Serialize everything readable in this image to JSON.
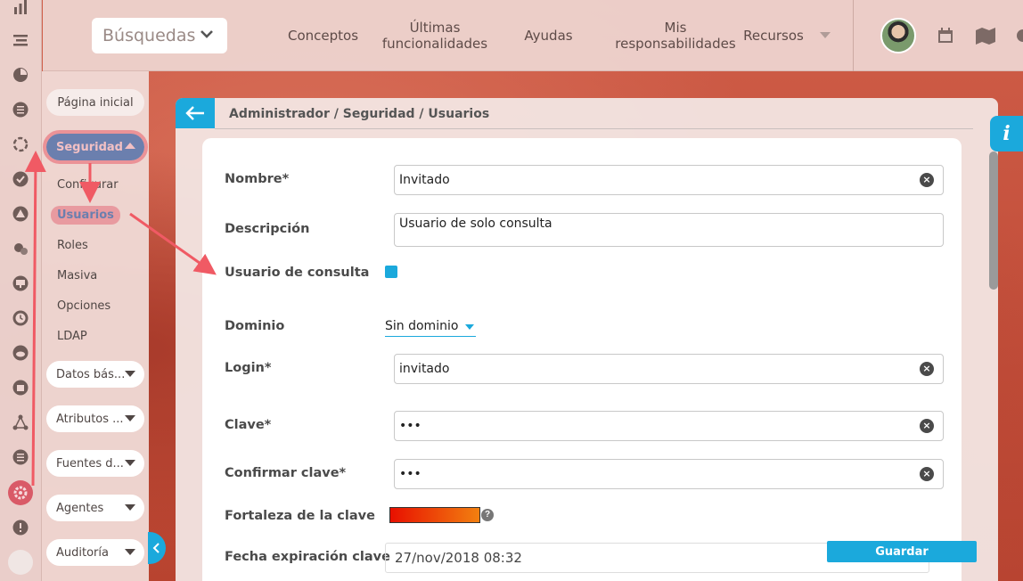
{
  "header": {
    "search_label": "Búsquedas",
    "nav": [
      {
        "label": "Conceptos"
      },
      {
        "label": "Últimas funcionalidades"
      },
      {
        "label": "Ayudas"
      },
      {
        "label": "Mis responsabilidades"
      },
      {
        "label": "Recursos"
      }
    ]
  },
  "submenu": {
    "home": "Página inicial",
    "security": "Seguridad",
    "security_items": [
      "Configurar",
      "Usuarios",
      "Roles",
      "Masiva",
      "Opciones",
      "LDAP"
    ],
    "groups": [
      "Datos bás...",
      "Atributos ...",
      "Fuentes d...",
      "Agentes",
      "Auditoría"
    ]
  },
  "rail_icons": [
    "chart-icon",
    "menu-icon",
    "pie-icon",
    "document-icon",
    "cycle-icon",
    "check-icon",
    "warning-icon",
    "gears-icon",
    "monitor-icon",
    "clock-icon",
    "cloud-icon",
    "calendar-icon",
    "network-icon",
    "list-icon",
    "settings-icon",
    "alert-icon"
  ],
  "panel": {
    "breadcrumb": "Administrador / Seguridad / Usuarios",
    "labels": {
      "name": "Nombre*",
      "description": "Descripción",
      "query_user": "Usuario de consulta",
      "domain": "Dominio",
      "login": "Login*",
      "password": "Clave*",
      "confirm_password": "Confirmar clave*",
      "strength": "Fortaleza de la clave",
      "expiration": "Fecha expiración clave"
    },
    "values": {
      "name": "Invitado",
      "description": "Usuario de solo consulta",
      "domain": "Sin dominio",
      "login": "invitado",
      "password": "•••",
      "confirm_password": "•••",
      "expiration": "27/nov/2018 08:32"
    },
    "query_user_checked": true,
    "save_label": "Guardar",
    "info_label": "i"
  },
  "colors": {
    "accent": "#1ba9dc",
    "highlight": "#e86e78"
  }
}
